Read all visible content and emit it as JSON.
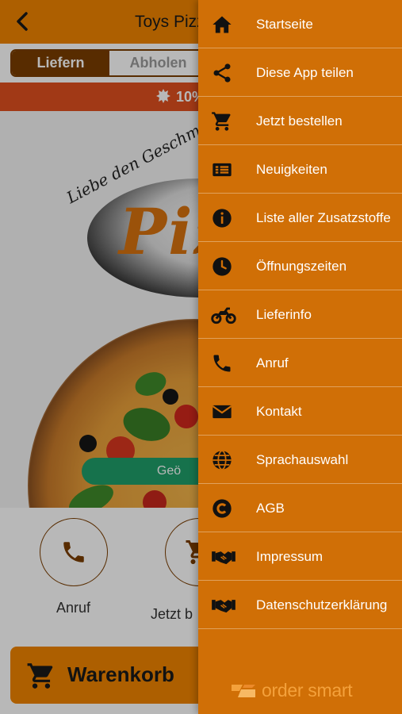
{
  "header": {
    "title": "Toys Pizz"
  },
  "order_mode": {
    "options": [
      "Liefern",
      "Abholen"
    ],
    "selected": "Liefern"
  },
  "promo": {
    "text": "10%"
  },
  "hero": {
    "logo_script": "Liebe den Geschmack",
    "logo_word": "Piz",
    "status_pill": "Geö"
  },
  "actions": [
    {
      "label": "Anruf",
      "icon": "phone-icon"
    },
    {
      "label": "Jetzt b",
      "icon": "cart-icon"
    }
  ],
  "cart": {
    "label": "Warenkorb"
  },
  "drawer": {
    "items": [
      {
        "label": "Startseite",
        "icon": "home-icon"
      },
      {
        "label": "Diese App teilen",
        "icon": "share-icon"
      },
      {
        "label": "Jetzt bestellen",
        "icon": "cart-icon"
      },
      {
        "label": "Neuigkeiten",
        "icon": "news-icon"
      },
      {
        "label": "Liste aller Zusatzstoffe",
        "icon": "info-icon"
      },
      {
        "label": "Öffnungszeiten",
        "icon": "clock-icon"
      },
      {
        "label": "Lieferinfo",
        "icon": "motorcycle-icon"
      },
      {
        "label": "Anruf",
        "icon": "phone-icon"
      },
      {
        "label": "Kontakt",
        "icon": "mail-icon"
      },
      {
        "label": "Sprachauswahl",
        "icon": "globe-icon"
      },
      {
        "label": "AGB",
        "icon": "copyright-icon"
      },
      {
        "label": "Impressum",
        "icon": "handshake-icon"
      },
      {
        "label": "Datenschutzerklärung",
        "icon": "handshake-icon"
      }
    ],
    "brand": "order smart"
  },
  "colors": {
    "primary": "#f08400",
    "drawer": "#d06f06",
    "dark_brown": "#7a3d00",
    "promo": "#e0501f",
    "open_green": "#1f9e6a"
  }
}
